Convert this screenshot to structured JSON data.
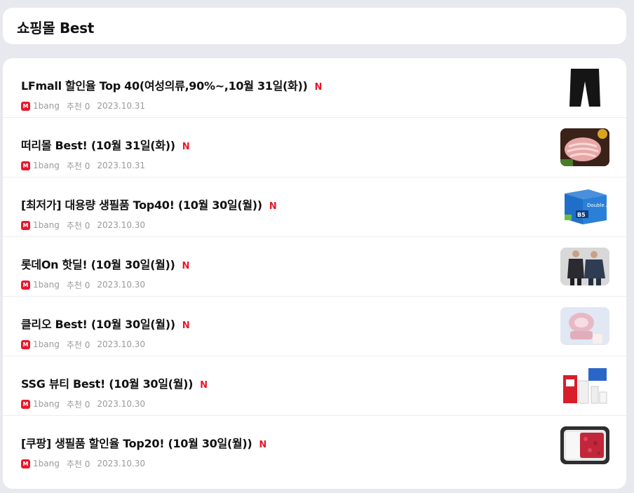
{
  "header": {
    "title": "쇼핑몰 Best"
  },
  "new_label": "N",
  "mall_icon_text": "M",
  "items": [
    {
      "title": "LFmall 할인율 Top 40(여성의류,90%~,10월 31일(화))",
      "author": "1bang",
      "recommend": "추천 0",
      "date": "2023.10.31",
      "thumb": "black-pants"
    },
    {
      "title": "떠리몰 Best! (10월 31일(화))",
      "author": "1bang",
      "recommend": "추천 0",
      "date": "2023.10.31",
      "thumb": "sliced-pork"
    },
    {
      "title": "[최저가] 대용량 생필품 Top40! (10월 30일(월))",
      "author": "1bang",
      "recommend": "추천 0",
      "date": "2023.10.30",
      "thumb": "paper-box-b5"
    },
    {
      "title": "롯데On 핫딜! (10월 30일(월))",
      "author": "1bang",
      "recommend": "추천 0",
      "date": "2023.10.30",
      "thumb": "men-suits"
    },
    {
      "title": "클리오 Best! (10월 30일(월))",
      "author": "1bang",
      "recommend": "추천 0",
      "date": "2023.10.30",
      "thumb": "pink-cosmetics"
    },
    {
      "title": "SSG 뷰티 Best! (10월 30일(월))",
      "author": "1bang",
      "recommend": "추천 0",
      "date": "2023.10.30",
      "thumb": "beauty-products"
    },
    {
      "title": "[쿠팡] 생필품 할인율 Top20! (10월 30일(월))",
      "author": "1bang",
      "recommend": "추천 0",
      "date": "2023.10.30",
      "thumb": "ground-meat"
    }
  ],
  "thumb_labels": {
    "paper_box": "B5",
    "paper_brand": "Double A"
  },
  "colors": {
    "new_badge": "#e8182a",
    "mall_icon": "#e8182a",
    "background": "#e8e9ee"
  }
}
